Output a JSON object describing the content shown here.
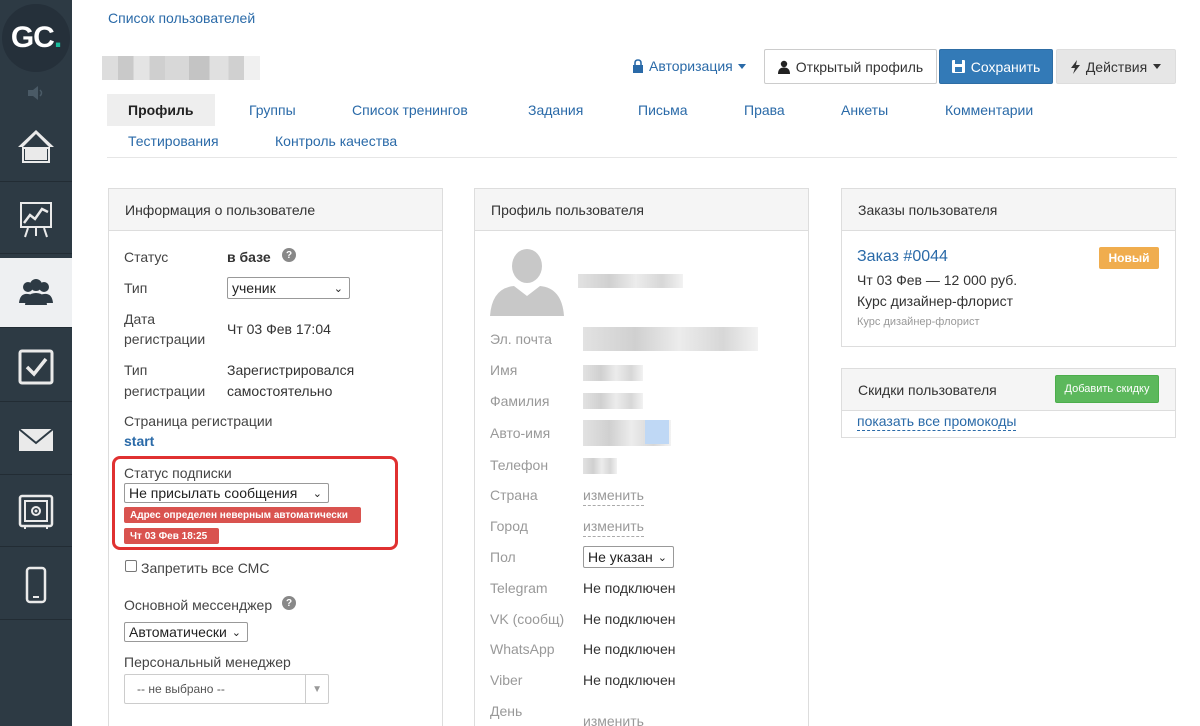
{
  "sidebar": {
    "logo_text": "GC",
    "logo_dot": ".",
    "items": [
      {
        "name": "home",
        "icon": "home-icon"
      },
      {
        "name": "stats",
        "icon": "chart-icon"
      },
      {
        "name": "users",
        "icon": "users-icon",
        "active": true
      },
      {
        "name": "tasks",
        "icon": "checkbox-icon"
      },
      {
        "name": "mail",
        "icon": "mail-icon"
      },
      {
        "name": "safe",
        "icon": "safe-icon"
      },
      {
        "name": "mobile",
        "icon": "phone-icon"
      }
    ]
  },
  "header": {
    "breadcrumb": "Список пользователей",
    "auth_label": "Авторизация",
    "open_profile_label": "Открытый профиль",
    "save_label": "Сохранить",
    "actions_label": "Действия"
  },
  "tabs": [
    {
      "label": "Профиль",
      "active": true
    },
    {
      "label": "Группы"
    },
    {
      "label": "Список тренингов"
    },
    {
      "label": "Задания"
    },
    {
      "label": "Письма"
    },
    {
      "label": "Права"
    },
    {
      "label": "Анкеты"
    },
    {
      "label": "Комментарии"
    },
    {
      "label": "Тестирования"
    },
    {
      "label": "Контроль качества"
    }
  ],
  "info_panel": {
    "title": "Информация о пользователе",
    "status_label": "Статус",
    "status_value": "в базе",
    "type_label": "Тип",
    "type_value": "ученик",
    "reg_date_label_1": "Дата",
    "reg_date_label_2": "регистрации",
    "reg_date_value": "Чт 03 Фев 17:04",
    "reg_type_label_1": "Тип",
    "reg_type_label_2": "регистрации",
    "reg_type_value_1": "Зарегистрировался",
    "reg_type_value_2": "самостоятельно",
    "reg_page_label": "Страница регистрации",
    "reg_page_value": "start",
    "sub_status_label": "Статус подписки",
    "sub_status_value": "Не присылать сообщения",
    "sub_badge_1": "Адрес определен неверным автоматически",
    "sub_badge_2": "Чт 03 Фев 18:25",
    "no_sms_label": "Запретить все СМС",
    "messenger_label": "Основной мессенджер",
    "messenger_value": "Автоматически",
    "manager_label": "Персональный менеджер",
    "manager_value": "-- не выбрано --"
  },
  "profile_panel": {
    "title": "Профиль пользователя",
    "fields": {
      "email": "Эл. почта",
      "first_name": "Имя",
      "last_name": "Фамилия",
      "auto_name": "Авто-имя",
      "phone": "Телефон",
      "country": "Страна",
      "country_value": "изменить",
      "city": "Город",
      "city_value": "изменить",
      "gender": "Пол",
      "gender_value": "Не указан",
      "telegram": "Telegram",
      "telegram_value": "Не подключен",
      "vk": "VK (сообщ)",
      "vk_value": "Не подключен",
      "whatsapp": "WhatsApp",
      "whatsapp_value": "Не подключен",
      "viber": "Viber",
      "viber_value": "Не подключен",
      "day": "День",
      "day_value": "изменить"
    }
  },
  "orders_panel": {
    "title": "Заказы пользователя",
    "order_link": "Заказ #0044",
    "order_badge": "Новый",
    "order_line": "Чт 03 Фев — 12 000 руб.",
    "order_product": "Курс дизайнер-флорист",
    "order_product_small": "Курс дизайнер-флорист"
  },
  "discounts_panel": {
    "title": "Скидки пользователя",
    "add_button": "Добавить скидку",
    "promo_link": "показать все промокоды"
  },
  "colors": {
    "sidebar_bg": "#2d3a44",
    "primary": "#337ab7",
    "link": "#2a6aa8",
    "danger": "#d9534f",
    "warning": "#f0ad4e",
    "success": "#5cb85c"
  }
}
